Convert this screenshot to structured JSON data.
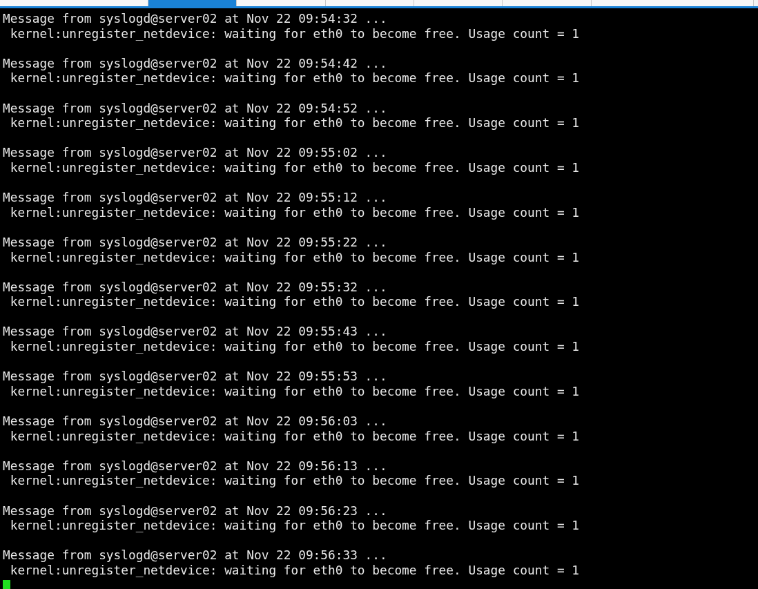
{
  "tabs": [
    {
      "selected": false
    },
    {
      "selected": true
    },
    {
      "selected": false
    },
    {
      "selected": false
    },
    {
      "selected": false
    },
    {
      "selected": false
    },
    {
      "selected": false
    }
  ],
  "terminal": {
    "lines": [
      "Message from syslogd@server02 at Nov 22 09:54:32 ...",
      " kernel:unregister_netdevice: waiting for eth0 to become free. Usage count = 1",
      "Message from syslogd@server02 at Nov 22 09:54:42 ...",
      " kernel:unregister_netdevice: waiting for eth0 to become free. Usage count = 1",
      "Message from syslogd@server02 at Nov 22 09:54:52 ...",
      " kernel:unregister_netdevice: waiting for eth0 to become free. Usage count = 1",
      "Message from syslogd@server02 at Nov 22 09:55:02 ...",
      " kernel:unregister_netdevice: waiting for eth0 to become free. Usage count = 1",
      "Message from syslogd@server02 at Nov 22 09:55:12 ...",
      " kernel:unregister_netdevice: waiting for eth0 to become free. Usage count = 1",
      "Message from syslogd@server02 at Nov 22 09:55:22 ...",
      " kernel:unregister_netdevice: waiting for eth0 to become free. Usage count = 1",
      "Message from syslogd@server02 at Nov 22 09:55:32 ...",
      " kernel:unregister_netdevice: waiting for eth0 to become free. Usage count = 1",
      "Message from syslogd@server02 at Nov 22 09:55:43 ...",
      " kernel:unregister_netdevice: waiting for eth0 to become free. Usage count = 1",
      "Message from syslogd@server02 at Nov 22 09:55:53 ...",
      " kernel:unregister_netdevice: waiting for eth0 to become free. Usage count = 1",
      "Message from syslogd@server02 at Nov 22 09:56:03 ...",
      " kernel:unregister_netdevice: waiting for eth0 to become free. Usage count = 1",
      "Message from syslogd@server02 at Nov 22 09:56:13 ...",
      " kernel:unregister_netdevice: waiting for eth0 to become free. Usage count = 1",
      "Message from syslogd@server02 at Nov 22 09:56:23 ...",
      " kernel:unregister_netdevice: waiting for eth0 to become free. Usage count = 1",
      "Message from syslogd@server02 at Nov 22 09:56:33 ...",
      " kernel:unregister_netdevice: waiting for eth0 to become free. Usage count = 1"
    ]
  }
}
